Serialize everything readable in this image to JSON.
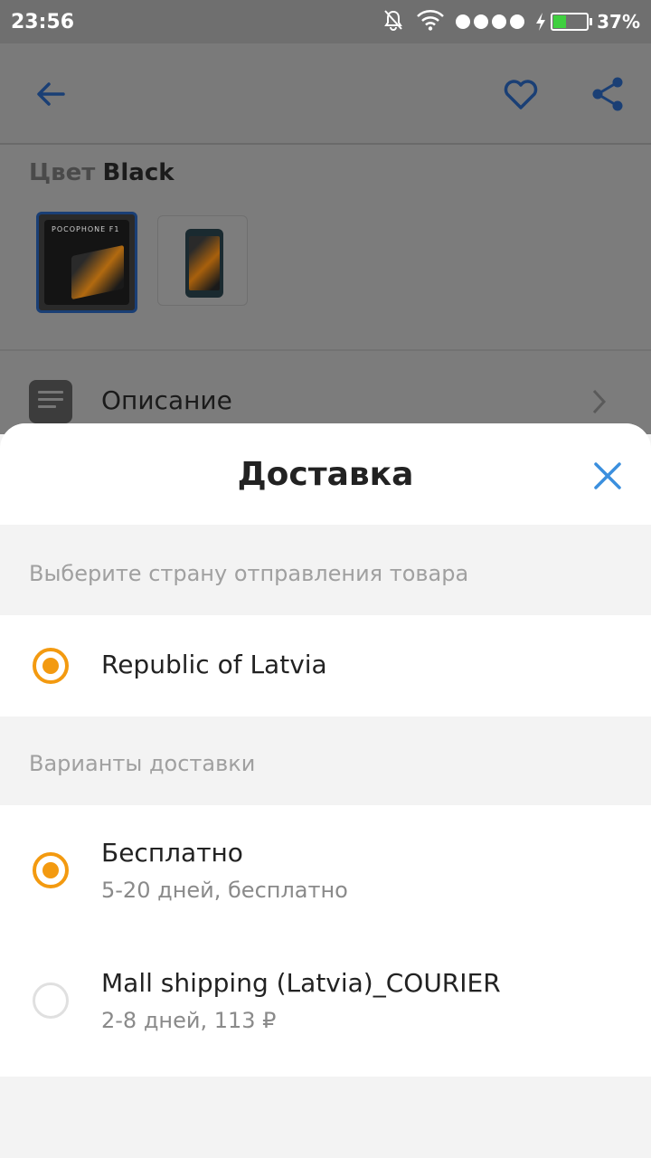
{
  "status_bar": {
    "time": "23:56",
    "battery_percent": "37%",
    "battery_level": 0.37,
    "signal_dots": 4,
    "icons": [
      "bell-off-icon",
      "wifi-icon",
      "signal-icon",
      "charging-icon",
      "battery-icon"
    ]
  },
  "app_bar": {
    "icons": [
      "back-arrow-icon",
      "heart-icon",
      "share-icon"
    ],
    "accent_color": "#1a3f75"
  },
  "product": {
    "color_label": "Цвет",
    "color_value": "Black",
    "thumbnail_brand_text": "POCOPHONE F1",
    "description_label": "Описание"
  },
  "sheet": {
    "title": "Доставка",
    "close_icon": "close-icon",
    "close_color": "#3b8fde",
    "radio_color": "#f39a10",
    "origin_section": {
      "heading": "Выберите страну отправления товара",
      "options": [
        {
          "title": "Republic of Latvia",
          "selected": true
        }
      ]
    },
    "shipping_section": {
      "heading": "Варианты доставки",
      "options": [
        {
          "title": "Бесплатно",
          "subtitle": "5-20 дней, бесплатно",
          "selected": true
        },
        {
          "title": "Mall shipping (Latvia)_COURIER",
          "subtitle": "2-8 дней, 113 ₽",
          "selected": false
        }
      ]
    }
  }
}
